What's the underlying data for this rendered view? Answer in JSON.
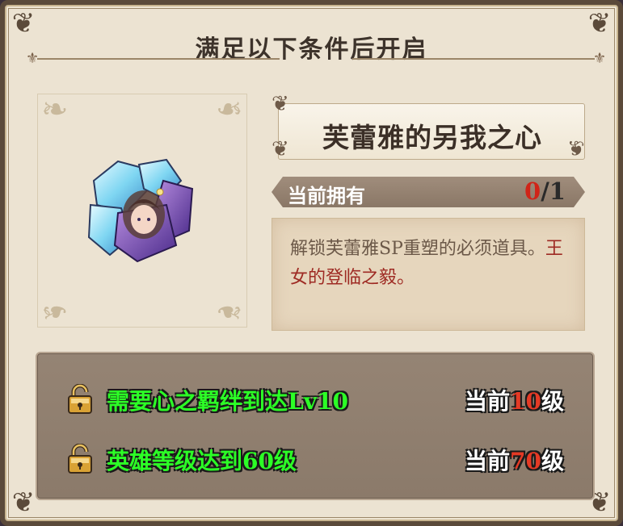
{
  "title": "满足以下条件后开启",
  "item": {
    "name": "芙蕾雅的另我之心",
    "owned_label": "当前拥有",
    "owned_current": "0",
    "owned_sep_total": "/1",
    "description_prefix": "解锁芙蕾雅SP重塑的必须道具。",
    "description_highlight": "王女的登临之毅",
    "description_suffix": "。"
  },
  "conditions": [
    {
      "text": "需要心之羁绊到达Lv10",
      "status_prefix": "当前",
      "status_value": "10",
      "status_suffix": "级"
    },
    {
      "text": "英雄等级达到60级",
      "status_prefix": "当前",
      "status_value": "70",
      "status_suffix": "级"
    }
  ],
  "colors": {
    "condition_text": "#2cff26",
    "status_number": "#e43a25",
    "owned_current": "#d02418",
    "description_highlight": "#9e2a23"
  },
  "icons": [
    "padlock-icon",
    "crystal-item-icon",
    "ornament-swirl-icon",
    "fleur-icon"
  ]
}
